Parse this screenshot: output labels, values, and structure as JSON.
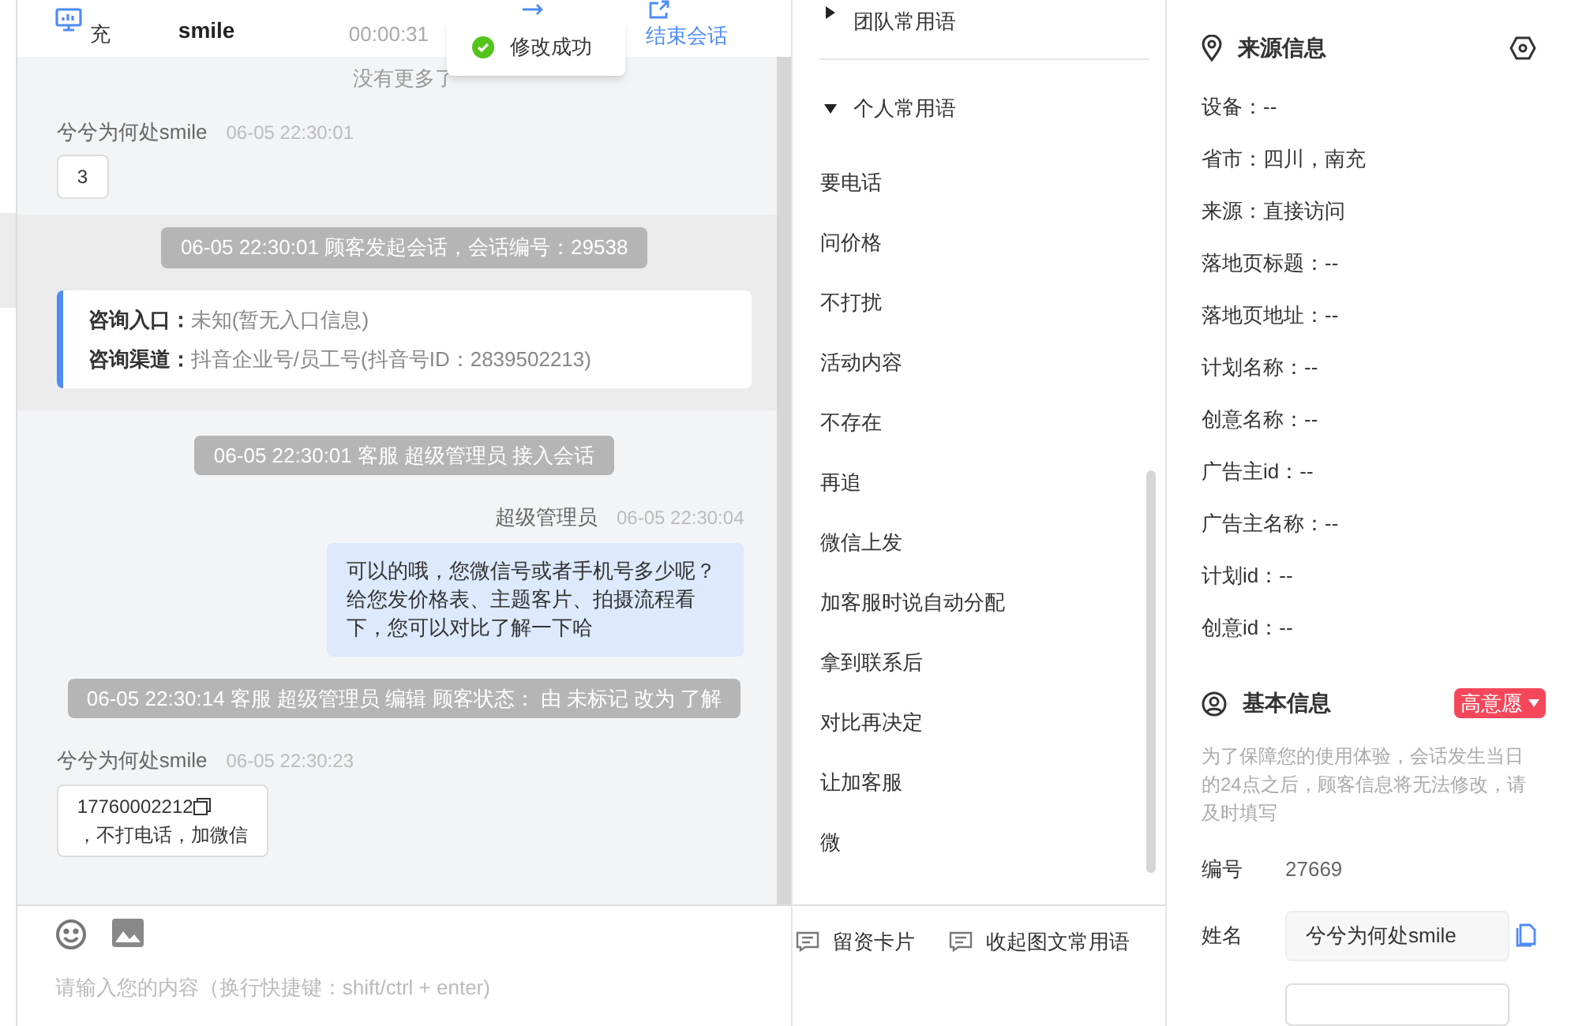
{
  "header": {
    "location": [
      "充"
    ],
    "customer_name": [
      "smile"
    ],
    "session_time": "00:00:31",
    "end_session": "结束会话"
  },
  "toast": {
    "text": "修改成功"
  },
  "messages": [
    {
      "kind": "notice",
      "text": "没有更多了"
    },
    {
      "kind": "customer",
      "name": "兮兮为何处smile",
      "time": "06-05 22:30:01",
      "text": "3"
    },
    {
      "kind": "system",
      "text": "06-05 22:30:01 顾客发起会话，会话编号：29538",
      "rows": [
        {
          "label": "咨询入口：",
          "value": "未知(暂无入口信息)"
        },
        {
          "label": "咨询渠道：",
          "value": "抖音企业号/员工号(抖音号ID：2839502213)"
        }
      ]
    },
    {
      "kind": "system",
      "text": "06-05 22:30:01 客服 超级管理员 接入会话"
    },
    {
      "kind": "agent",
      "name": "超级管理员",
      "time": "06-05 22:30:04",
      "text": "可以的哦，您微信号或者手机号多少呢？给您发价格表、主题客片、拍摄流程看下，您可以对比了解一下哈"
    },
    {
      "kind": "system",
      "text": "06-05 22:30:14 客服 超级管理员 编辑 顾客状态： 由 未标记 改为 了解"
    },
    {
      "kind": "customer",
      "name": "兮兮为何处smile",
      "time": "06-05 22:30:23",
      "phone": "17760002212",
      "text": "，不打电话，加微信"
    }
  ],
  "input": {
    "placeholder": "请输入您的内容（换行快捷键：shift/ctrl + enter)"
  },
  "phrase_groups": [
    {
      "title": "团队常用语",
      "expanded": false
    },
    {
      "title": "个人常用语",
      "expanded": true
    }
  ],
  "phrases": [
    "要电话",
    "问价格",
    "不打扰",
    "活动内容",
    "不存在",
    "再追",
    "微信上发",
    "加客服时说自动分配",
    "拿到联系后",
    "对比再决定",
    "让加客服",
    "微"
  ],
  "phrase_actions": [
    "留资卡片",
    "收起图文常用语"
  ],
  "source_info": {
    "title": "来源信息",
    "fields": [
      "设备：--",
      "省市：四川，南充",
      "来源：直接访问",
      "落地页标题：--",
      "落地页地址：--",
      "计划名称：--",
      "创意名称：--",
      "广告主id：--",
      "广告主名称：--",
      "计划id：--",
      "创意id：--"
    ]
  },
  "basic_info": {
    "title": "基本信息",
    "tag": "高意愿",
    "note": "为了保障您的使用体验，会话发生当日的24点之后，顾客信息将无法修改，请及时填写",
    "number_label": "编号",
    "number": "27669",
    "name_label": "姓名",
    "name_value": "兮兮为何处smile"
  }
}
